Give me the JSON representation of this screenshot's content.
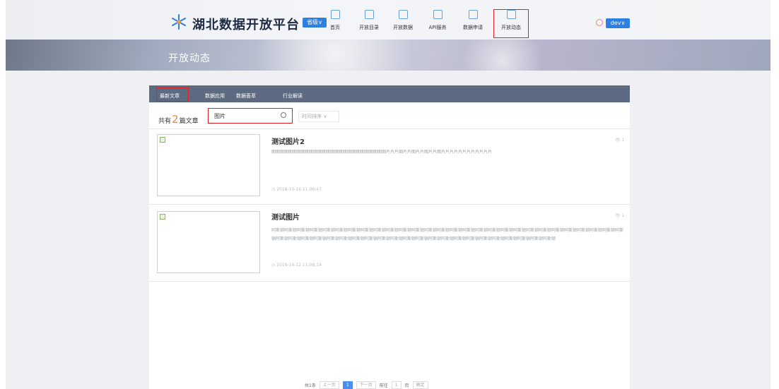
{
  "header": {
    "site_title": "湖北数据开放平台",
    "region_label": "省级",
    "user_label": "dev",
    "nav": [
      {
        "label": "首页",
        "icon": "home-icon"
      },
      {
        "label": "开放目录",
        "icon": "folder-icon"
      },
      {
        "label": "开放数据",
        "icon": "database-icon"
      },
      {
        "label": "API服务",
        "icon": "api-icon"
      },
      {
        "label": "数据申请",
        "icon": "apply-icon"
      },
      {
        "label": "开放动态",
        "icon": "news-icon"
      }
    ]
  },
  "banner": {
    "title": "开放动态"
  },
  "tabs": [
    "最新文章",
    "数据应用",
    "数据荟萃",
    "行业解读"
  ],
  "list": {
    "count_prefix": "共有",
    "count": "2",
    "count_suffix": "篇文章",
    "search_value": "图片",
    "sort_placeholder": "时间排序"
  },
  "articles": [
    {
      "title": "测试图片2",
      "summary": "图图图图图图图图图图图图图图图图图图图图图图图图图图图片片片图片片图片片图片片图片片片片片片片片片片片片",
      "date": "2018-10-16 11:06:47",
      "views": "1"
    },
    {
      "title": "测试图片",
      "summary": "阿斯顿阿斯顿阿斯顿阿斯顿阿斯顿阿斯顿阿斯顿阿斯顿阿斯顿阿斯顿阿斯顿阿斯顿阿斯顿阿斯顿阿斯顿阿斯顿阿斯顿阿斯顿阿斯顿阿斯顿阿斯顿阿斯顿阿斯顿阿斯顿阿斯顿阿斯顿阿斯顿阿斯顿阿斯顿阿斯顿阿斯顿阿斯顿阿斯顿阿斯顿阿斯顿阿斯顿阿斯顿阿斯顿阿斯顿阿斯顿阿斯顿阿斯顿阿斯顿阿斯顿阿斯顿阿斯顿阿斯顿阿斯顿阿斯顿阿斯顿",
      "date": "2018-10-12 11:08:14",
      "views": "1"
    }
  ],
  "pager": {
    "total": "共1条",
    "prev": "上一页",
    "page": "1",
    "next": "下一页",
    "goto_label": "前往",
    "goto_value": "1",
    "page_unit": "页",
    "confirm": "确定"
  }
}
